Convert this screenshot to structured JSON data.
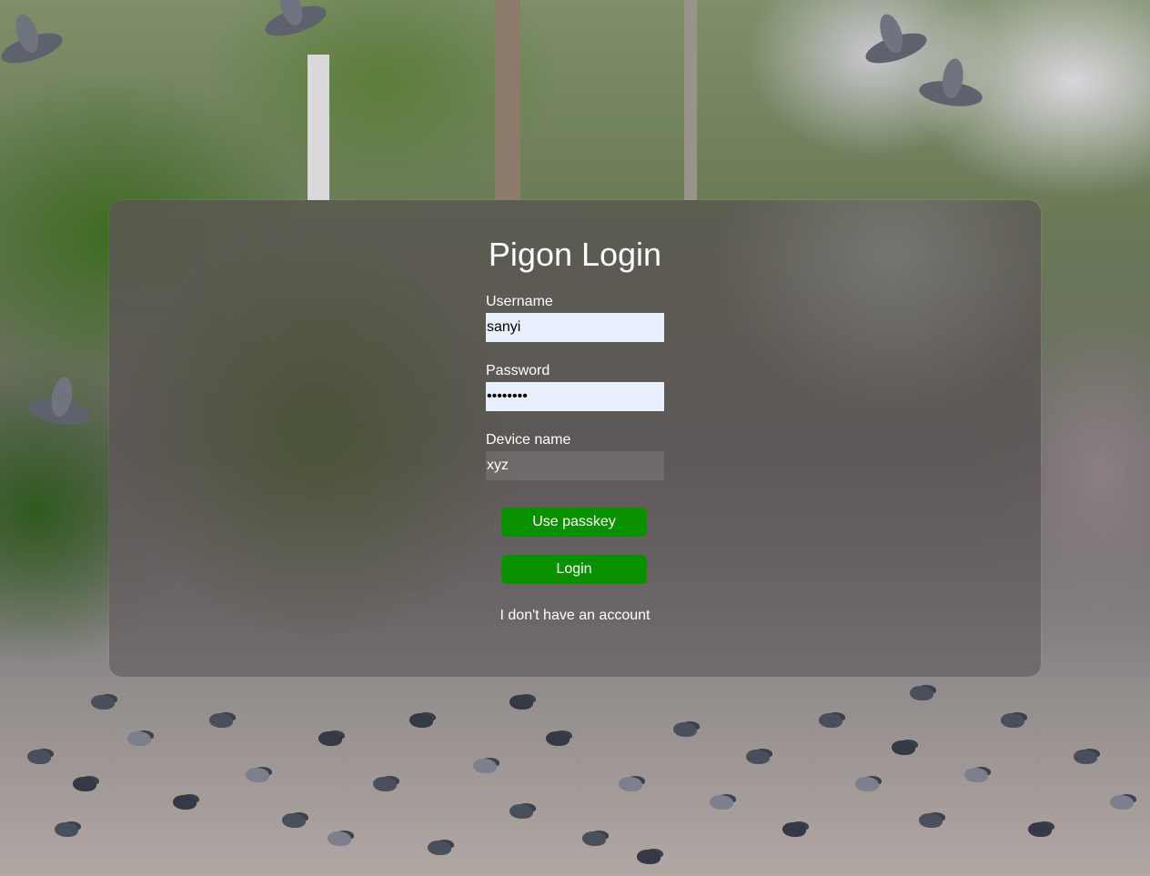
{
  "page": {
    "title": "Pigon Login"
  },
  "form": {
    "username_label": "Username",
    "username_value": "sanyi",
    "password_label": "Password",
    "password_value": "••••••••",
    "device_label": "Device name",
    "device_value": "xyz",
    "passkey_button": "Use passkey",
    "login_button": "Login",
    "no_account_link": "I don't have an account"
  },
  "colors": {
    "button_green": "#0a9100",
    "autofill_field": "#e8f0fe",
    "text": "#ffffff"
  }
}
